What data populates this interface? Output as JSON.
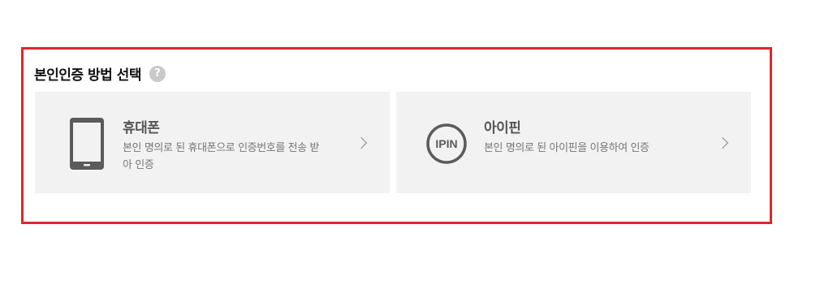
{
  "section": {
    "title": "본인인증 방법 선택",
    "help_icon": "question-mark-icon"
  },
  "options": [
    {
      "icon": "mobile-phone-icon",
      "title": "휴대폰",
      "description": "본인 명의로 된 휴대폰으로 인증번호를 전송 받아 인증"
    },
    {
      "icon": "ipin-icon",
      "icon_text": "IPIN",
      "title": "아이핀",
      "description": "본인 명의로 된 아이핀을 이용하여 인증"
    }
  ],
  "colors": {
    "frame_border": "#e3242b",
    "card_bg": "#f2f2f2",
    "icon": "#5b5b5b"
  }
}
